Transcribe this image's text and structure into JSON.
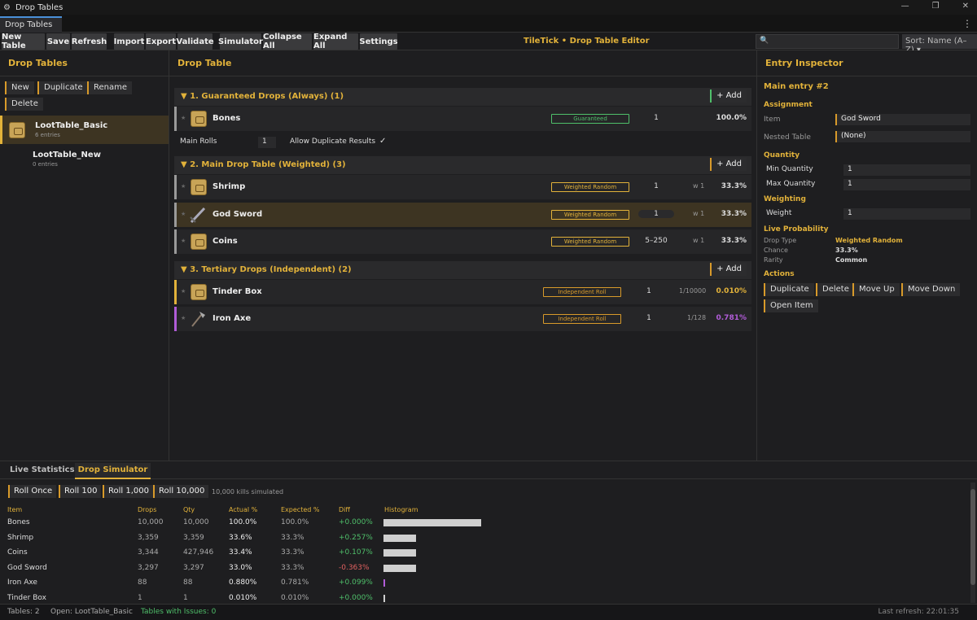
{
  "window": {
    "title": "Drop Tables",
    "tab": "Drop Tables"
  },
  "toolbar": {
    "buttons": [
      "New Table",
      "Save",
      "Refresh",
      "Import",
      "Export",
      "Validate",
      "Simulator",
      "Collapse All",
      "Expand All",
      "Settings"
    ],
    "brand": "TileTick  •  Drop Table Editor",
    "search_placeholder": "",
    "sort": "Sort: Name (A–Z) ▾"
  },
  "left": {
    "title": "Drop Tables",
    "actions": [
      "New",
      "Duplicate",
      "Rename",
      "Delete"
    ],
    "tables": [
      {
        "name": "LootTable_Basic",
        "count": "6 entries"
      },
      {
        "name": "LootTable_New",
        "count": "0 entries"
      }
    ]
  },
  "mid": {
    "title": "Drop Table",
    "add_label": "+ Add",
    "sections": [
      {
        "header": "1. Guaranteed Drops (Always)   (1)"
      },
      {
        "header": "2. Main Drop Table (Weighted)   (3)"
      },
      {
        "header": "3. Tertiary Drops (Independent)   (2)"
      }
    ],
    "rows": [
      {
        "name": "Bones",
        "tag": "Guaranteed",
        "qty": "1",
        "w": "",
        "pct": "100.0%"
      },
      {
        "name": "Shrimp",
        "tag": "Weighted Random",
        "qty": "1",
        "w": "w 1",
        "pct": "33.3%"
      },
      {
        "name": "God Sword",
        "tag": "Weighted Random",
        "qty": "1",
        "w": "w 1",
        "pct": "33.3%"
      },
      {
        "name": "Coins",
        "tag": "Weighted Random",
        "qty": "5–250",
        "w": "w 1",
        "pct": "33.3%"
      },
      {
        "name": "Tinder Box",
        "tag": "Independent Roll",
        "qty": "1",
        "w": "1/10000",
        "pct": "0.010%"
      },
      {
        "name": "Iron Axe",
        "tag": "Independent Roll",
        "qty": "1",
        "w": "1/128",
        "pct": "0.781%"
      }
    ],
    "main_rolls_label": "Main Rolls",
    "main_rolls_value": "1",
    "allow_dup_label": "Allow Duplicate Results",
    "check": "✓"
  },
  "inspector": {
    "title": "Entry Inspector",
    "entry": "Main entry #2",
    "assignment": "Assignment",
    "item_label": "Item",
    "item_value": "God Sword",
    "nested_label": "Nested Table",
    "nested_value": "(None)",
    "quantity": "Quantity",
    "min_label": "Min Quantity",
    "min_value": "1",
    "max_label": "Max Quantity",
    "max_value": "1",
    "weighting": "Weighting",
    "weight_label": "Weight",
    "weight_value": "1",
    "live": "Live Probability",
    "droptype_label": "Drop Type",
    "droptype_value": "Weighted Random",
    "chance_label": "Chance",
    "chance_value": "33.3%",
    "rarity_label": "Rarity",
    "rarity_value": "Common",
    "actions": "Actions",
    "action_buttons": [
      "Duplicate",
      "Delete",
      "Move Up",
      "Move Down",
      "Open Item"
    ]
  },
  "simulator": {
    "tabs": [
      "Live Statistics",
      "Drop Simulator"
    ],
    "roll_buttons": [
      "Roll Once",
      "Roll 100",
      "Roll 1,000",
      "Roll 10,000"
    ],
    "info": "10,000 kills simulated",
    "headers": [
      "Item",
      "Drops",
      "Qty",
      "Actual %",
      "Expected %",
      "Diff",
      "Histogram"
    ],
    "rows": [
      {
        "item": "Bones",
        "drops": "10,000",
        "qty": "10,000",
        "actual": "100.0%",
        "expected": "100.0%",
        "diff": "+0.000%",
        "hist": 1.0
      },
      {
        "item": "Shrimp",
        "drops": "3,359",
        "qty": "3,359",
        "actual": "33.6%",
        "expected": "33.3%",
        "diff": "+0.257%",
        "hist": 0.336
      },
      {
        "item": "Coins",
        "drops": "3,344",
        "qty": "427,946",
        "actual": "33.4%",
        "expected": "33.3%",
        "diff": "+0.107%",
        "hist": 0.334
      },
      {
        "item": "God Sword",
        "drops": "3,297",
        "qty": "3,297",
        "actual": "33.0%",
        "expected": "33.3%",
        "diff": "-0.363%",
        "hist": 0.33
      },
      {
        "item": "Iron Axe",
        "drops": "88",
        "qty": "88",
        "actual": "0.880%",
        "expected": "0.781%",
        "diff": "+0.099%",
        "hist": 0.0088
      },
      {
        "item": "Tinder Box",
        "drops": "1",
        "qty": "1",
        "actual": "0.010%",
        "expected": "0.010%",
        "diff": "+0.000%",
        "hist": 0.0001
      }
    ]
  },
  "status": {
    "tables": "Tables: 2",
    "open": "Open: LootTable_Basic",
    "issues": "Tables with Issues: 0",
    "refresh": "Last refresh: 22:01:35"
  },
  "colors": {
    "accent": "#e2b23a",
    "guaranteed": "#4fbf6a",
    "independent": "#d89a2a",
    "purple": "#b15cd8"
  }
}
